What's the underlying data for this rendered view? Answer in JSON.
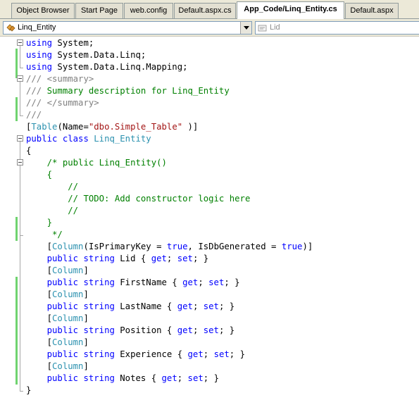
{
  "tabs": [
    {
      "label": "Object Browser",
      "active": false
    },
    {
      "label": "Start Page",
      "active": false
    },
    {
      "label": "web.config",
      "active": false
    },
    {
      "label": "Default.aspx.cs",
      "active": false
    },
    {
      "label": "App_Code/Linq_Entity.cs",
      "active": true
    },
    {
      "label": "Default.aspx",
      "active": false
    }
  ],
  "navbar": {
    "type_combo": "Linq_Entity",
    "member_combo": "Lid"
  },
  "code_lines": [
    [
      "kw:using",
      " System;"
    ],
    [
      "kw:using",
      " System.Data.Linq;"
    ],
    [
      "kw:using",
      " System.Data.Linq.Mapping;"
    ],
    [
      "xd:///",
      " ",
      "xd:<summary>"
    ],
    [
      "xd:///",
      "cm: Summary description for Linq_Entity"
    ],
    [
      "xd:///",
      " ",
      "xd:</summary>"
    ],
    [
      "xd:///"
    ],
    [
      "[",
      "ty:Table",
      "(Name=",
      "st:\"dbo.Simple_Table\"",
      " )]"
    ],
    [
      "kw:public",
      " ",
      "kw:class",
      " ",
      "ty:Linq_Entity"
    ],
    [
      "{"
    ],
    [
      "    ",
      "cm:/* public Linq_Entity()"
    ],
    [
      "    ",
      "cm:{"
    ],
    [
      "        ",
      "cm://"
    ],
    [
      "        ",
      "cm:// TODO: Add constructor logic here"
    ],
    [
      "        ",
      "cm://"
    ],
    [
      "    ",
      "cm:}"
    ],
    [
      "     ",
      "cm:*/"
    ],
    [
      "    [",
      "ty:Column",
      "(IsPrimaryKey = ",
      "kw:true",
      ", IsDbGenerated = ",
      "kw:true",
      ")]"
    ],
    [
      "    ",
      "kw:public",
      " ",
      "kw:string",
      " Lid { ",
      "kw:get",
      "; ",
      "kw:set",
      "; }"
    ],
    [
      "    [",
      "ty:Column",
      "]"
    ],
    [
      "    ",
      "kw:public",
      " ",
      "kw:string",
      " FirstName { ",
      "kw:get",
      "; ",
      "kw:set",
      "; }"
    ],
    [
      "    [",
      "ty:Column",
      "]"
    ],
    [
      "    ",
      "kw:public",
      " ",
      "kw:string",
      " LastName { ",
      "kw:get",
      "; ",
      "kw:set",
      "; }"
    ],
    [
      "    [",
      "ty:Column",
      "]"
    ],
    [
      "    ",
      "kw:public",
      " ",
      "kw:string",
      " Position { ",
      "kw:get",
      "; ",
      "kw:set",
      "; }"
    ],
    [
      "    [",
      "ty:Column",
      "]"
    ],
    [
      "    ",
      "kw:public",
      " ",
      "kw:string",
      " Experience { ",
      "kw:get",
      "; ",
      "kw:set",
      "; }"
    ],
    [
      "    [",
      "ty:Column",
      "]"
    ],
    [
      "    ",
      "kw:public",
      " ",
      "kw:string",
      " Notes { ",
      "kw:get",
      "; ",
      "kw:set",
      "; }"
    ],
    [
      "}"
    ]
  ],
  "colors": {
    "keyword": "#0000ff",
    "comment": "#008000",
    "xmldoc": "#808080",
    "type": "#2b91af",
    "string": "#a31515",
    "changed_line_marker": "#6fd36f"
  }
}
